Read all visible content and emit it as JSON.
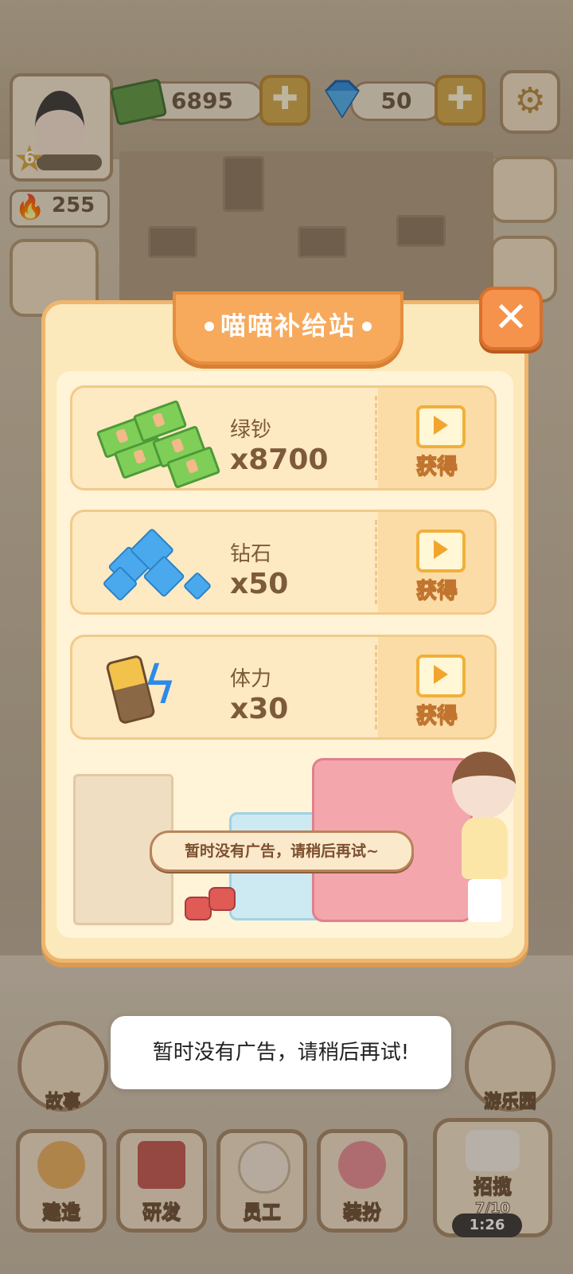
{
  "hud": {
    "level": "6",
    "cash": "6895",
    "diamonds": "50",
    "energy": "255",
    "plus_symbol": "✚",
    "fire_symbol": "🔥",
    "gear_symbol": "⚙"
  },
  "popup": {
    "title": "喵喵补给站",
    "close_symbol": "✕",
    "items": [
      {
        "label": "绿钞",
        "amount": "x8700",
        "button": "获得",
        "icon": "cash-stack-icon"
      },
      {
        "label": "钻石",
        "amount": "x50",
        "button": "获得",
        "icon": "diamond-pile-icon"
      },
      {
        "label": "体力",
        "amount": "x30",
        "button": "获得",
        "icon": "battery-energy-icon"
      }
    ],
    "note": "暂时没有广告，请稍后再试~"
  },
  "bottom": {
    "story": "故事",
    "park": "游乐园",
    "build": "建造",
    "research": "研发",
    "staff": "员工",
    "dress": "装扮",
    "recruit": "招揽",
    "recruit_count": "7/10",
    "timer": "1:26"
  },
  "toast": "暂时没有广告，请稍后再试!",
  "colors": {
    "popup_bg": "#fbe8bb",
    "title_tab": "#f7a95c",
    "close_btn": "#f5924c",
    "item_bg": "#fde9c2"
  }
}
